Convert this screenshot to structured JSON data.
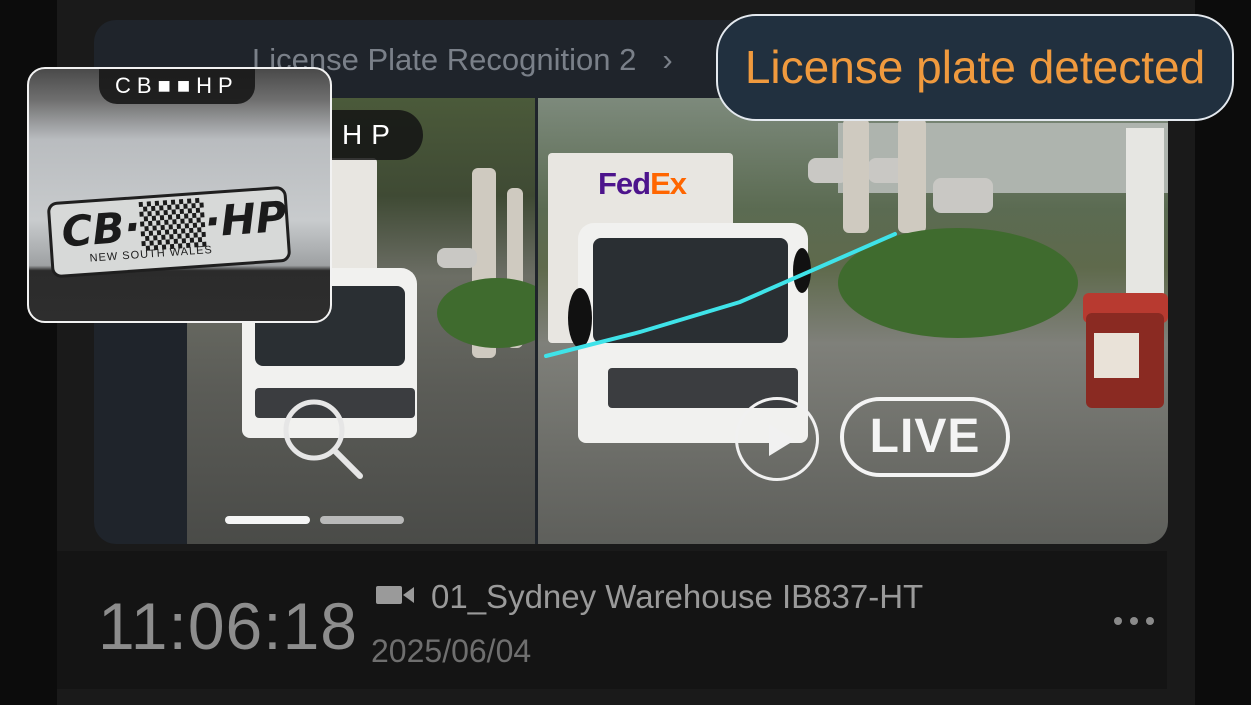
{
  "header": {
    "breadcrumb_title": "License Plate Recognition 2",
    "breadcrumb_separator": "›"
  },
  "toast": {
    "message": "License plate detected"
  },
  "magnifier": {
    "plate_tag": "CB■■HP",
    "plate_text": "CB·▒▒·HP",
    "plate_region": "NEW SOUTH WALES"
  },
  "thumbnail": {
    "plate_tag": "HP",
    "pager": {
      "current": 1,
      "total": 2
    }
  },
  "live": {
    "badge": "LIVE",
    "brand_fe": "Fed",
    "brand_ex": "Ex"
  },
  "event": {
    "time": "11:06:18",
    "camera_name": "01_Sydney Warehouse IB837-HT",
    "date": "2025/06/04"
  },
  "colors": {
    "toast_text": "#f09a3e",
    "toast_bg": "#21303f",
    "detection_line": "#3fe3e9",
    "card_bg": "#1f242b"
  },
  "icons": [
    "zoom-icon",
    "play-icon",
    "camera-icon",
    "more-icon"
  ]
}
